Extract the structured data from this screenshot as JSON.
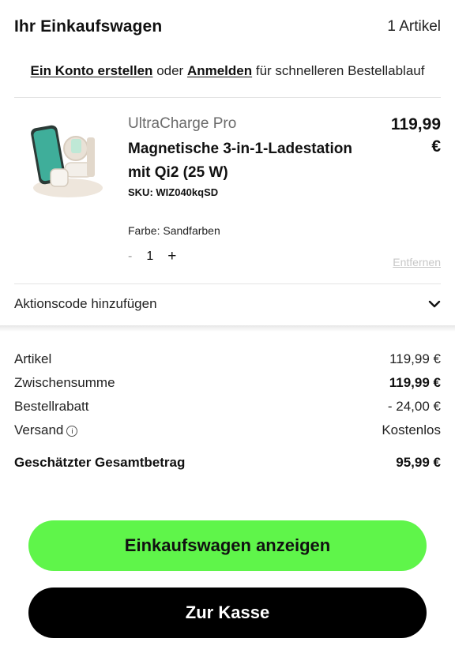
{
  "header": {
    "title": "Ihr Einkaufswagen",
    "count": "1 Artikel"
  },
  "account": {
    "create_link": "Ein Konto erstellen",
    "or_text": "oder",
    "login_link": "Anmelden",
    "suffix_text": "für schnelleren Bestellablauf"
  },
  "item": {
    "brand": "UltraCharge Pro",
    "name": "Magnetische 3-in-1-Ladestation mit Qi2 (25 W)",
    "sku": "SKU: WIZ040kqSD",
    "color": "Farbe: Sandfarben",
    "qty_minus": "-",
    "qty": "1",
    "qty_plus": "+",
    "price_amount": "119,99",
    "price_currency": "€",
    "remove": "Entfernen"
  },
  "promo": {
    "label": "Aktionscode hinzufügen"
  },
  "summary": {
    "rows": [
      {
        "label": "Artikel",
        "value": "119,99 €"
      },
      {
        "label": "Zwischensumme",
        "value": "119,99 €"
      },
      {
        "label": "Bestellrabatt",
        "value": "- 24,00 €"
      },
      {
        "label": "Versand",
        "value": "Kostenlos"
      }
    ],
    "total_label": "Geschätzter Gesamtbetrag",
    "total_value": "95,99 €"
  },
  "buttons": {
    "view_cart": "Einkaufswagen anzeigen",
    "checkout": "Zur Kasse"
  },
  "colors": {
    "accent_green": "#5ff54a",
    "checkout_black": "#000000"
  },
  "icons": {
    "promo_toggle": "chevron-down-icon",
    "shipping_info": "info-icon"
  }
}
